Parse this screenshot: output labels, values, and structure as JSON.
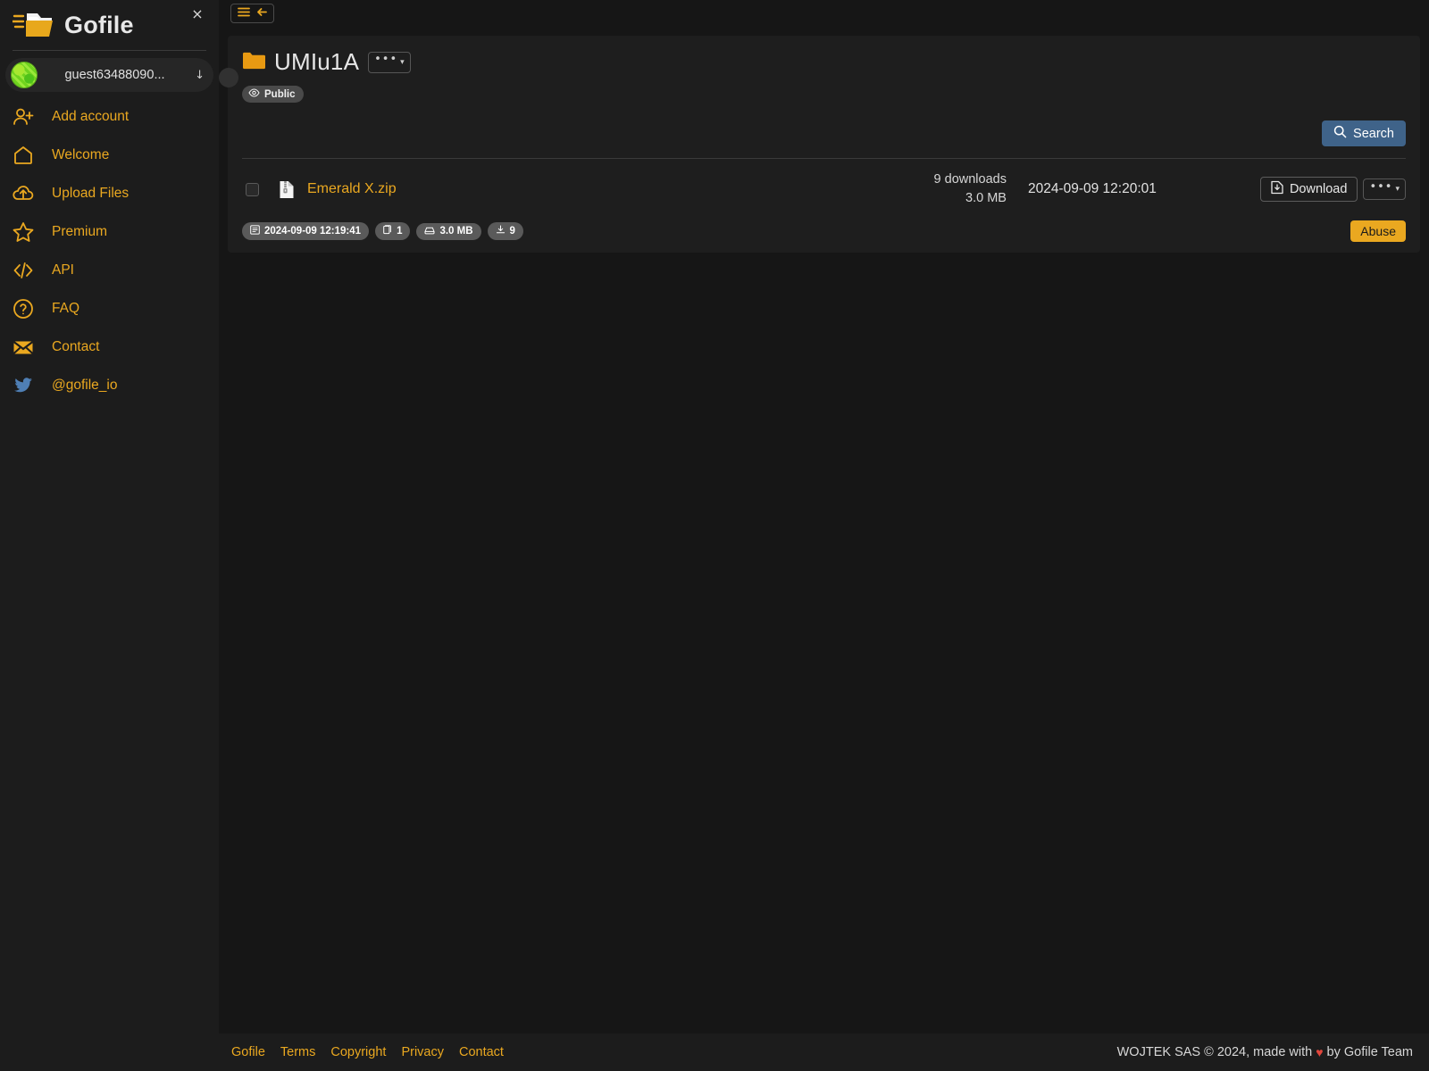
{
  "sidebar": {
    "close_label": "×",
    "brand": {
      "title": "Gofile",
      "logo_icon": "gofile-folder-logo"
    },
    "account": {
      "name": "guest63488090...",
      "caret": "↓",
      "avatar_icon": "identicon-avatar"
    },
    "add_account": {
      "label": "Add account",
      "icon": "user-plus-icon"
    },
    "items": [
      {
        "label": "Welcome",
        "icon": "home-icon"
      },
      {
        "label": "Upload Files",
        "icon": "cloud-upload-icon"
      },
      {
        "label": "Premium",
        "icon": "star-icon"
      },
      {
        "label": "API",
        "icon": "code-brackets-icon"
      },
      {
        "label": "FAQ",
        "icon": "question-circle-icon"
      },
      {
        "label": "Contact",
        "icon": "envelope-icon"
      },
      {
        "label": "@gofile_io",
        "icon": "twitter-icon"
      }
    ]
  },
  "topbar": {
    "menu_icon": "hamburger-icon",
    "back_icon": "arrow-left-icon"
  },
  "folder": {
    "name": "UMIu1A",
    "folder_icon": "folder-icon",
    "options_dots": "•••",
    "options_caret": "▾",
    "visibility_badge": "Public",
    "visibility_icon": "eye-icon"
  },
  "search": {
    "label": "Search",
    "icon": "search-icon"
  },
  "file": {
    "name": "Emerald X.zip",
    "file_icon": "zip-file-icon",
    "downloads_text": "9 downloads",
    "size_text": "3.0 MB",
    "date": "2024-09-09 12:20:01",
    "download_label": "Download",
    "download_icon": "file-download-icon",
    "options_dots": "•••",
    "options_caret": "▾"
  },
  "meta_badges": [
    {
      "label": "2024-09-09 12:19:41",
      "icon": "calendar-icon"
    },
    {
      "label": "1",
      "icon": "files-count-icon"
    },
    {
      "label": "3.0 MB",
      "icon": "hard-drive-icon"
    },
    {
      "label": "9",
      "icon": "download-count-icon"
    }
  ],
  "abuse": {
    "label": "Abuse"
  },
  "footer": {
    "links": [
      "Gofile",
      "Terms",
      "Copyright",
      "Privacy",
      "Contact"
    ],
    "credit_before": "WOJTEK SAS © 2024, made with",
    "heart": "♥",
    "credit_after": "by Gofile Team"
  },
  "colors": {
    "accent": "#eaa820",
    "page_bg": "#161616",
    "sidebar_bg": "#1c1c1c",
    "card_bg": "#1e1e1e",
    "search_blue": "#3f6389",
    "twitter_blue": "#4f7fb5",
    "heart_red": "#e0463c"
  }
}
